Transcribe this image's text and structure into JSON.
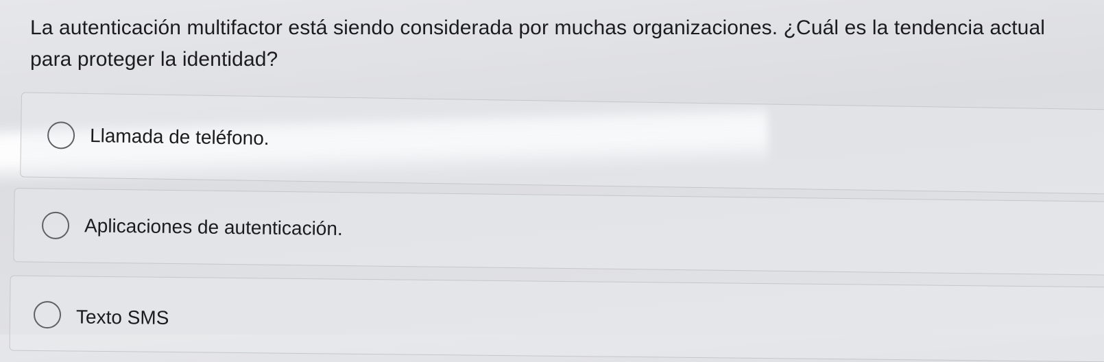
{
  "question": {
    "text": "La autenticación multifactor está siendo considerada por muchas organizaciones. ¿Cuál es la tendencia actual para proteger la identidad?"
  },
  "options": [
    {
      "label": "Llamada de teléfono.",
      "selected": false
    },
    {
      "label": "Aplicaciones de autenticación.",
      "selected": false
    },
    {
      "label": "Texto SMS",
      "selected": false
    }
  ],
  "colors": {
    "background": "#e2e3e6",
    "text": "#1c1c1e",
    "radio_border": "#5f6063",
    "option_border": "#c6c7cb"
  }
}
